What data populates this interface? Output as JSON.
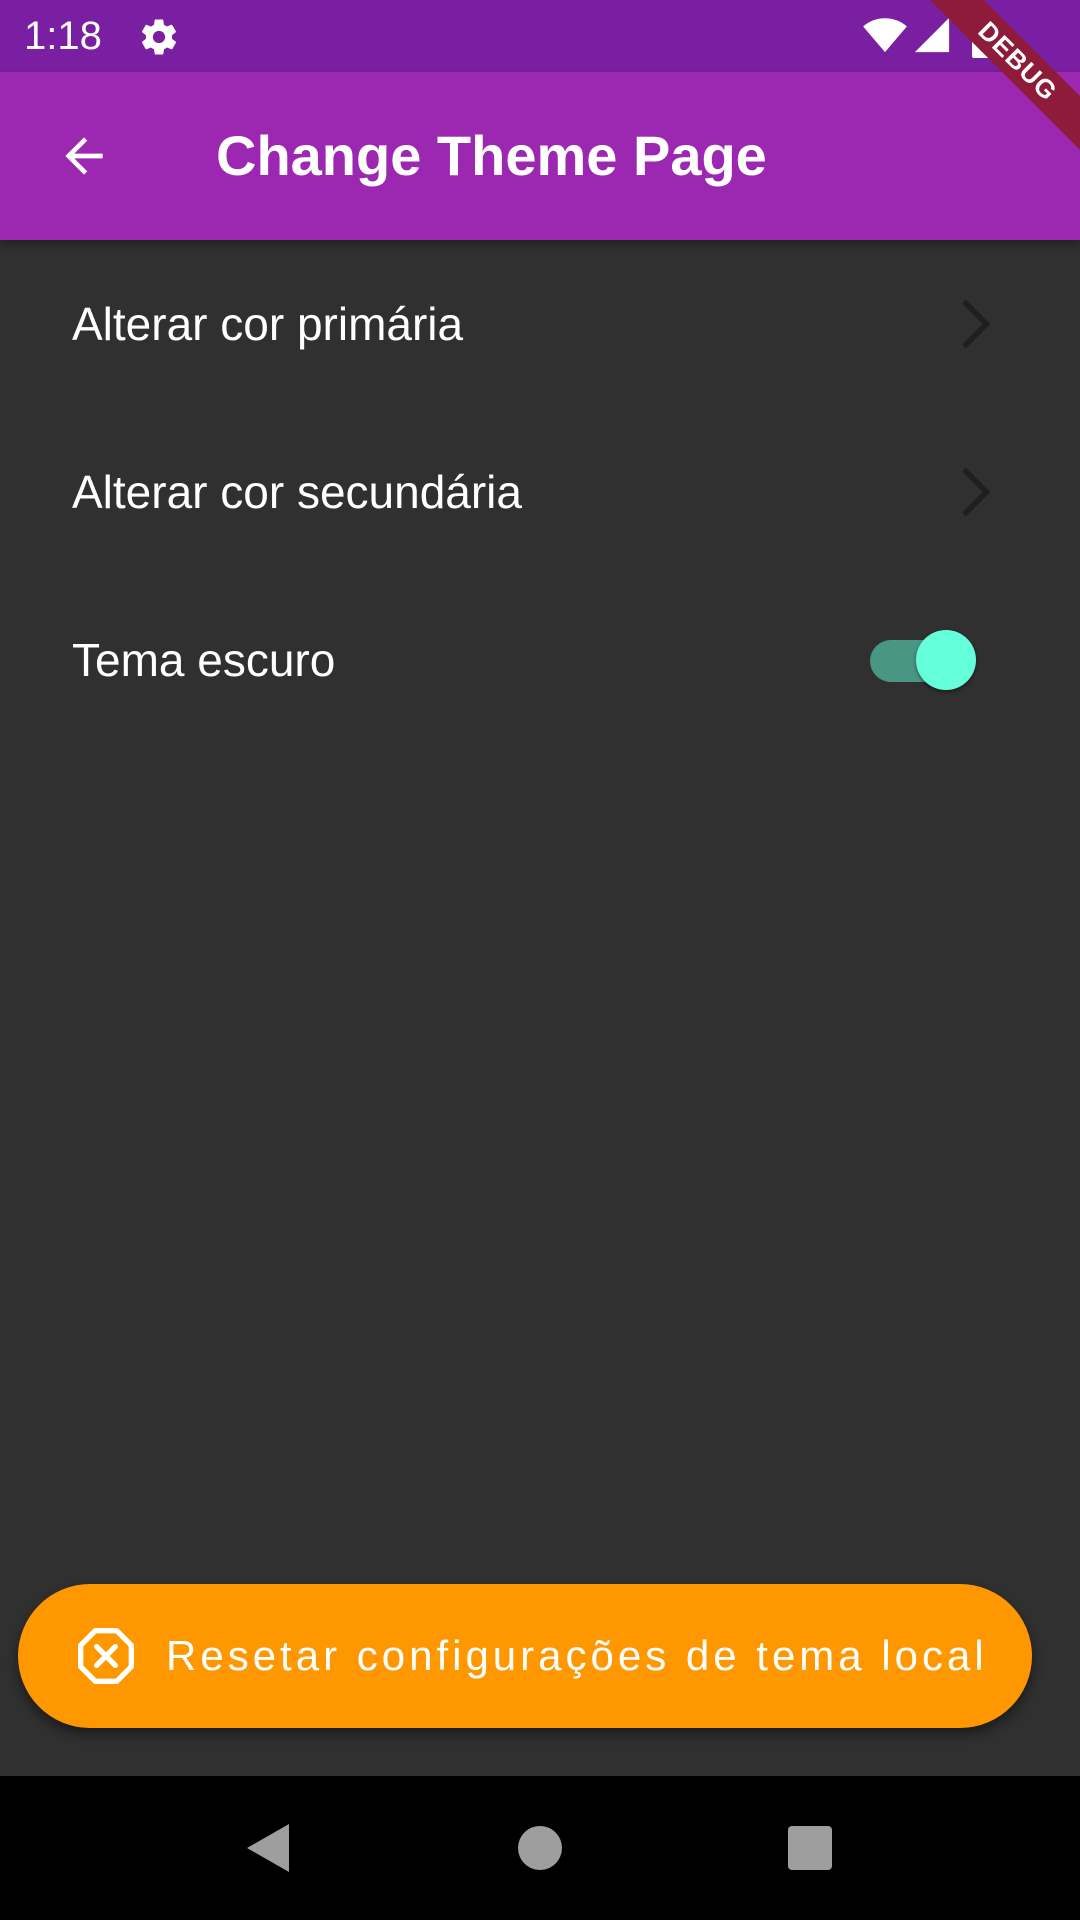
{
  "status_bar": {
    "time": "1:18",
    "icons": [
      "gear-icon",
      "wifi-icon",
      "signal-icon",
      "battery-icon"
    ],
    "color": "#7b1fa2"
  },
  "app_bar": {
    "title": "Change Theme Page",
    "back_icon": "arrow-back-icon",
    "color": "#9c27b0"
  },
  "debug_banner": {
    "label": "DEBUG"
  },
  "settings": {
    "items": [
      {
        "label": "Alterar cor primária",
        "trailing": "chevron-right-icon"
      },
      {
        "label": "Alterar cor secundária",
        "trailing": "chevron-right-icon"
      },
      {
        "label": "Tema escuro",
        "trailing": "toggle",
        "value": true
      }
    ]
  },
  "reset_button": {
    "label": "Resetar configurações de tema local",
    "icon": "cancel-octagon-icon",
    "color": "#ff9800"
  },
  "nav_bar": {
    "buttons": [
      "nav-back-icon",
      "nav-home-icon",
      "nav-recents-icon"
    ]
  },
  "colors": {
    "background": "#303030",
    "toggle_accent": "#64ffda"
  }
}
